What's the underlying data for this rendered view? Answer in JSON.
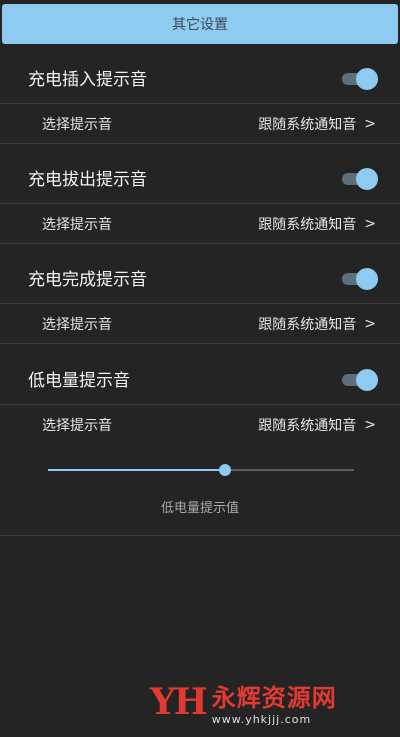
{
  "header": {
    "title": "其它设置"
  },
  "sections": [
    {
      "label": "充电插入提示音",
      "enabled": true,
      "sub_label": "选择提示音",
      "sub_value": "跟随系统通知音"
    },
    {
      "label": "充电拔出提示音",
      "enabled": true,
      "sub_label": "选择提示音",
      "sub_value": "跟随系统通知音"
    },
    {
      "label": "充电完成提示音",
      "enabled": true,
      "sub_label": "选择提示音",
      "sub_value": "跟随系统通知音"
    },
    {
      "label": "低电量提示音",
      "enabled": true,
      "sub_label": "选择提示音",
      "sub_value": "跟随系统通知音"
    }
  ],
  "chevron": ">",
  "low_battery_slider": {
    "value_fraction": 0.58,
    "caption": "低电量提示值"
  },
  "watermark": {
    "logo": "YH",
    "name": "永辉资源网",
    "url": "www.yhkjjj.com"
  },
  "colors": {
    "accent": "#8fcaf0",
    "background": "#242424",
    "watermark": "#e03a32"
  }
}
